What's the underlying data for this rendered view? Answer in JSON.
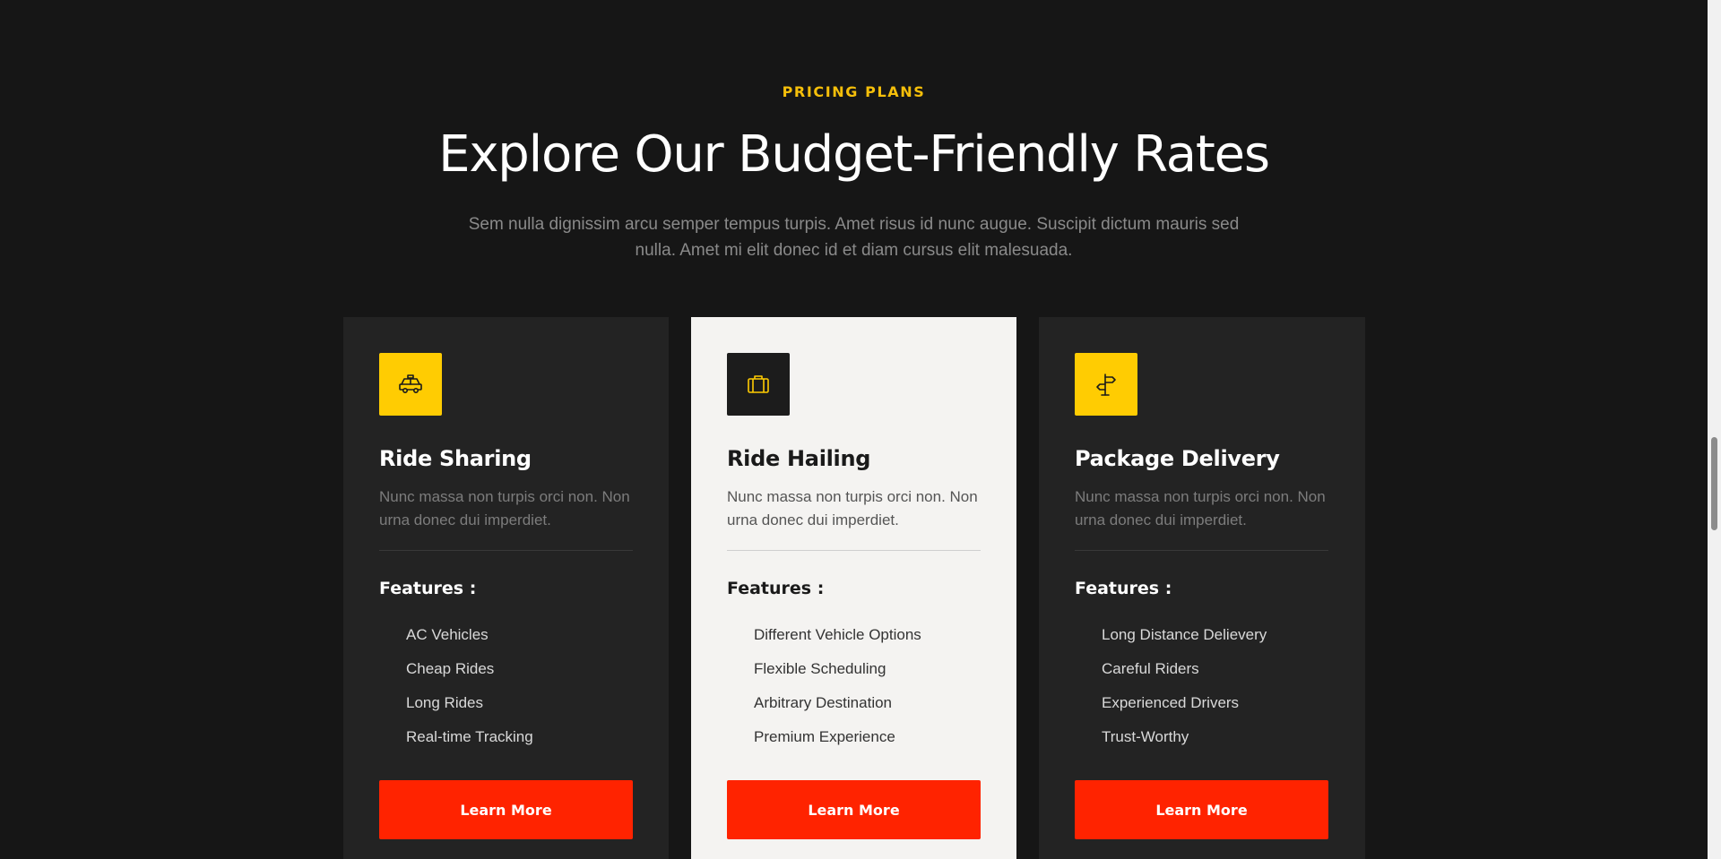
{
  "section": {
    "eyebrow": "PRICING PLANS",
    "title": "Explore Our Budget-Friendly Rates",
    "description": "Sem nulla dignissim arcu semper tempus turpis. Amet risus id nunc augue. Suscipit dictum mauris sed nulla. Amet mi elit donec id et diam cursus elit malesuada."
  },
  "colors": {
    "accent": "#ffcc02",
    "button": "#ff2300",
    "background": "#161616",
    "card_dark": "#232323",
    "card_light": "#f4f3f1"
  },
  "plans": [
    {
      "icon": "taxi-car-icon",
      "title": "Ride Sharing",
      "description": "Nunc massa non turpis orci non. Non urna donec dui imperdiet.",
      "features_title": "Features :",
      "features": [
        "AC Vehicles",
        "Cheap Rides",
        "Long Rides",
        "Real-time Tracking"
      ],
      "button_label": "Learn More"
    },
    {
      "icon": "briefcase-icon",
      "title": "Ride Hailing",
      "description": "Nunc massa non turpis orci non. Non urna donec dui imperdiet.",
      "features_title": "Features :",
      "features": [
        "Different Vehicle Options",
        "Flexible Scheduling",
        "Arbitrary Destination",
        "Premium Experience"
      ],
      "button_label": "Learn More"
    },
    {
      "icon": "signpost-icon",
      "title": "Package Delivery",
      "description": "Nunc massa non turpis orci non. Non urna donec dui imperdiet.",
      "features_title": "Features :",
      "features": [
        "Long Distance Delievery",
        "Careful Riders",
        "Experienced Drivers",
        "Trust-Worthy"
      ],
      "button_label": "Learn More"
    }
  ]
}
